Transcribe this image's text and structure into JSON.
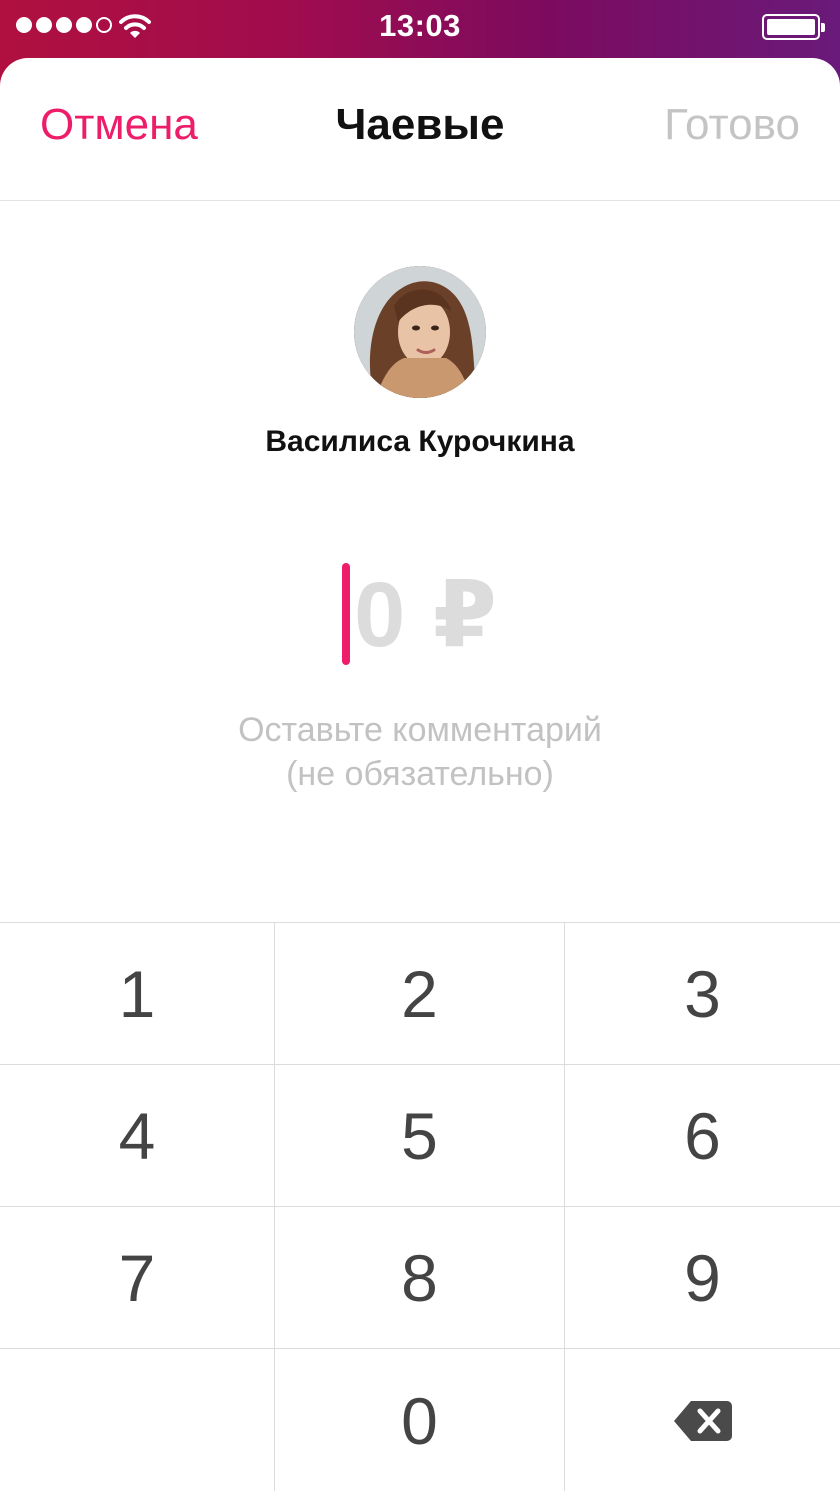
{
  "status_bar": {
    "time": "13:03",
    "icons": [
      "signal-dots",
      "wifi-icon",
      "battery-icon"
    ]
  },
  "nav": {
    "cancel_label": "Отмена",
    "title": "Чаевые",
    "done_label": "Готово"
  },
  "recipient": {
    "name": "Василиса Курочкина"
  },
  "amount": {
    "value": "0 ₽"
  },
  "comment": {
    "line1": "Оставьте комментарий",
    "line2": "(не обязательно)"
  },
  "keypad": {
    "keys": [
      "1",
      "2",
      "3",
      "4",
      "5",
      "6",
      "7",
      "8",
      "9",
      "",
      "0",
      "backspace-icon"
    ]
  },
  "colors": {
    "accent": "#ee1d6a",
    "disabled": "#c4c4c4",
    "status_bar_start": "#b0103f",
    "status_bar_end": "#6a1a7a"
  }
}
